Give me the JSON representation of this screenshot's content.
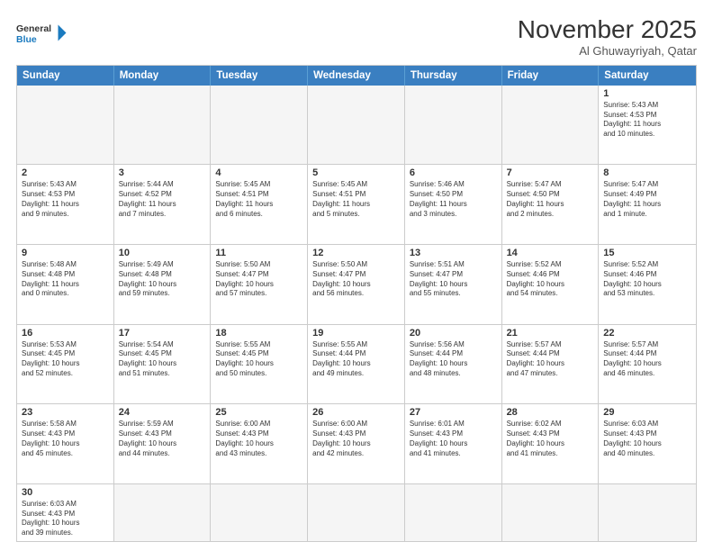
{
  "logo": {
    "text_general": "General",
    "text_blue": "Blue"
  },
  "title": "November 2025",
  "location": "Al Ghuwayriyah, Qatar",
  "weekdays": [
    "Sunday",
    "Monday",
    "Tuesday",
    "Wednesday",
    "Thursday",
    "Friday",
    "Saturday"
  ],
  "weeks": [
    [
      {
        "day": "",
        "info": ""
      },
      {
        "day": "",
        "info": ""
      },
      {
        "day": "",
        "info": ""
      },
      {
        "day": "",
        "info": ""
      },
      {
        "day": "",
        "info": ""
      },
      {
        "day": "",
        "info": ""
      },
      {
        "day": "1",
        "info": "Sunrise: 5:43 AM\nSunset: 4:53 PM\nDaylight: 11 hours\nand 10 minutes."
      }
    ],
    [
      {
        "day": "2",
        "info": "Sunrise: 5:43 AM\nSunset: 4:53 PM\nDaylight: 11 hours\nand 9 minutes."
      },
      {
        "day": "3",
        "info": "Sunrise: 5:44 AM\nSunset: 4:52 PM\nDaylight: 11 hours\nand 7 minutes."
      },
      {
        "day": "4",
        "info": "Sunrise: 5:45 AM\nSunset: 4:51 PM\nDaylight: 11 hours\nand 6 minutes."
      },
      {
        "day": "5",
        "info": "Sunrise: 5:45 AM\nSunset: 4:51 PM\nDaylight: 11 hours\nand 5 minutes."
      },
      {
        "day": "6",
        "info": "Sunrise: 5:46 AM\nSunset: 4:50 PM\nDaylight: 11 hours\nand 3 minutes."
      },
      {
        "day": "7",
        "info": "Sunrise: 5:47 AM\nSunset: 4:50 PM\nDaylight: 11 hours\nand 2 minutes."
      },
      {
        "day": "8",
        "info": "Sunrise: 5:47 AM\nSunset: 4:49 PM\nDaylight: 11 hours\nand 1 minute."
      }
    ],
    [
      {
        "day": "9",
        "info": "Sunrise: 5:48 AM\nSunset: 4:48 PM\nDaylight: 11 hours\nand 0 minutes."
      },
      {
        "day": "10",
        "info": "Sunrise: 5:49 AM\nSunset: 4:48 PM\nDaylight: 10 hours\nand 59 minutes."
      },
      {
        "day": "11",
        "info": "Sunrise: 5:50 AM\nSunset: 4:47 PM\nDaylight: 10 hours\nand 57 minutes."
      },
      {
        "day": "12",
        "info": "Sunrise: 5:50 AM\nSunset: 4:47 PM\nDaylight: 10 hours\nand 56 minutes."
      },
      {
        "day": "13",
        "info": "Sunrise: 5:51 AM\nSunset: 4:47 PM\nDaylight: 10 hours\nand 55 minutes."
      },
      {
        "day": "14",
        "info": "Sunrise: 5:52 AM\nSunset: 4:46 PM\nDaylight: 10 hours\nand 54 minutes."
      },
      {
        "day": "15",
        "info": "Sunrise: 5:52 AM\nSunset: 4:46 PM\nDaylight: 10 hours\nand 53 minutes."
      }
    ],
    [
      {
        "day": "16",
        "info": "Sunrise: 5:53 AM\nSunset: 4:45 PM\nDaylight: 10 hours\nand 52 minutes."
      },
      {
        "day": "17",
        "info": "Sunrise: 5:54 AM\nSunset: 4:45 PM\nDaylight: 10 hours\nand 51 minutes."
      },
      {
        "day": "18",
        "info": "Sunrise: 5:55 AM\nSunset: 4:45 PM\nDaylight: 10 hours\nand 50 minutes."
      },
      {
        "day": "19",
        "info": "Sunrise: 5:55 AM\nSunset: 4:44 PM\nDaylight: 10 hours\nand 49 minutes."
      },
      {
        "day": "20",
        "info": "Sunrise: 5:56 AM\nSunset: 4:44 PM\nDaylight: 10 hours\nand 48 minutes."
      },
      {
        "day": "21",
        "info": "Sunrise: 5:57 AM\nSunset: 4:44 PM\nDaylight: 10 hours\nand 47 minutes."
      },
      {
        "day": "22",
        "info": "Sunrise: 5:57 AM\nSunset: 4:44 PM\nDaylight: 10 hours\nand 46 minutes."
      }
    ],
    [
      {
        "day": "23",
        "info": "Sunrise: 5:58 AM\nSunset: 4:43 PM\nDaylight: 10 hours\nand 45 minutes."
      },
      {
        "day": "24",
        "info": "Sunrise: 5:59 AM\nSunset: 4:43 PM\nDaylight: 10 hours\nand 44 minutes."
      },
      {
        "day": "25",
        "info": "Sunrise: 6:00 AM\nSunset: 4:43 PM\nDaylight: 10 hours\nand 43 minutes."
      },
      {
        "day": "26",
        "info": "Sunrise: 6:00 AM\nSunset: 4:43 PM\nDaylight: 10 hours\nand 42 minutes."
      },
      {
        "day": "27",
        "info": "Sunrise: 6:01 AM\nSunset: 4:43 PM\nDaylight: 10 hours\nand 41 minutes."
      },
      {
        "day": "28",
        "info": "Sunrise: 6:02 AM\nSunset: 4:43 PM\nDaylight: 10 hours\nand 41 minutes."
      },
      {
        "day": "29",
        "info": "Sunrise: 6:03 AM\nSunset: 4:43 PM\nDaylight: 10 hours\nand 40 minutes."
      }
    ],
    [
      {
        "day": "30",
        "info": "Sunrise: 6:03 AM\nSunset: 4:43 PM\nDaylight: 10 hours\nand 39 minutes."
      },
      {
        "day": "",
        "info": ""
      },
      {
        "day": "",
        "info": ""
      },
      {
        "day": "",
        "info": ""
      },
      {
        "day": "",
        "info": ""
      },
      {
        "day": "",
        "info": ""
      },
      {
        "day": "",
        "info": ""
      }
    ]
  ]
}
